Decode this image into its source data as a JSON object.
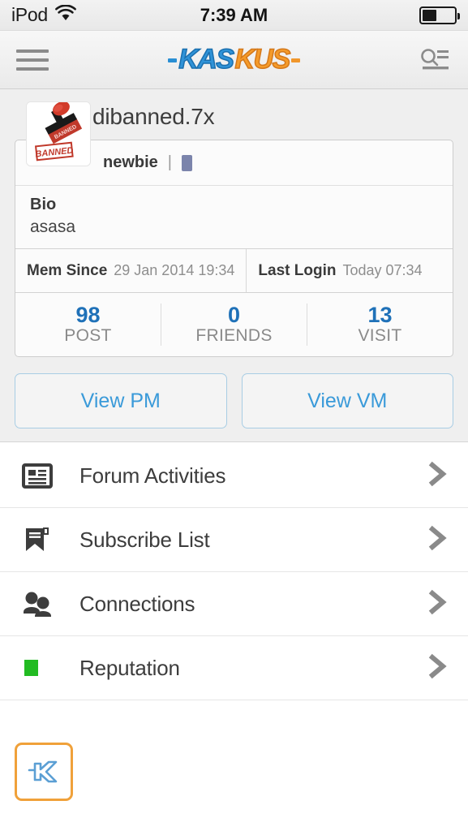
{
  "status_bar": {
    "carrier": "iPod",
    "wifi_icon": "wifi-icon",
    "time": "7:39 AM",
    "battery_icon": "battery-icon",
    "battery_percent": 45
  },
  "nav_bar": {
    "menu_icon": "hamburger-menu-icon",
    "search_icon": "search-icon",
    "logo": {
      "part1": "KAS",
      "part2": "KUS",
      "color1": "#2f93d8",
      "color2": "#f59b2a"
    }
  },
  "profile": {
    "username": "dibanned.7x",
    "avatar_icon": "banned-stamp-avatar",
    "avatar_alt": "BANNED",
    "usertitle": "newbie",
    "separator": "|",
    "rank_badge_color": "#7b84ab",
    "bio_label": "Bio",
    "bio_text": "asasa",
    "meta": [
      {
        "label": "Mem Since",
        "value": "29 Jan 2014 19:34"
      },
      {
        "label": "Last Login",
        "value": "Today 07:34"
      }
    ],
    "stats": [
      {
        "value": "98",
        "label": "POST"
      },
      {
        "value": "0",
        "label": "FRIENDS"
      },
      {
        "value": "13",
        "label": "VISIT"
      }
    ],
    "stat_color": "#1f71b8"
  },
  "actions": [
    {
      "label": "View PM",
      "name": "view-pm-button"
    },
    {
      "label": "View VM",
      "name": "view-vm-button"
    }
  ],
  "menu": [
    {
      "label": "Forum Activities",
      "icon": "newspaper-icon",
      "name": "menu-item-forum-activities"
    },
    {
      "label": "Subscribe List",
      "icon": "bookmark-icon",
      "name": "menu-item-subscribe-list"
    },
    {
      "label": "Connections",
      "icon": "people-icon",
      "name": "menu-item-connections"
    },
    {
      "label": "Reputation",
      "icon": "green-square-icon",
      "name": "menu-item-reputation"
    }
  ],
  "footer": {
    "logo_icon": "kaskus-k-logo",
    "border_color": "#f0a13a",
    "glyph_color": "#5b9fd4"
  }
}
